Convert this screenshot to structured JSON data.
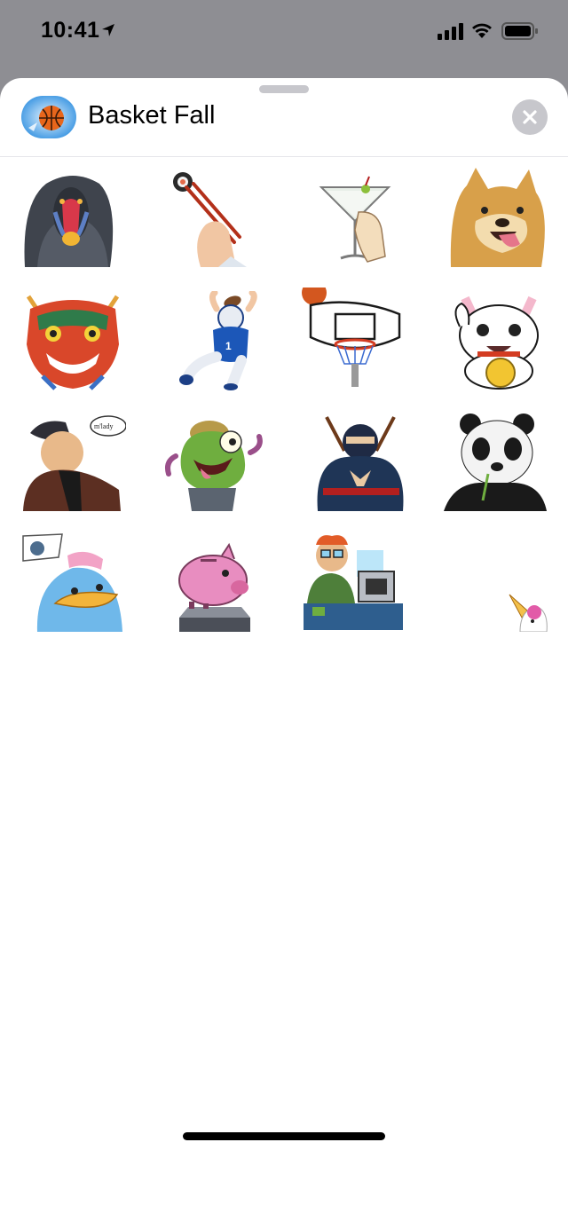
{
  "status_bar": {
    "time": "10:41"
  },
  "header": {
    "app_name": "Basket Fall",
    "app_icon": "basketball-game-icon",
    "close_icon": "close-icon"
  },
  "stickers": [
    {
      "name": "mandrill-baboon"
    },
    {
      "name": "chopsticks-sushi"
    },
    {
      "name": "martini-glass"
    },
    {
      "name": "shiba-dog"
    },
    {
      "name": "chinese-dragon-mask"
    },
    {
      "name": "football-player"
    },
    {
      "name": "basketball-hoop"
    },
    {
      "name": "lucky-cat"
    },
    {
      "name": "fedora-man",
      "text": "m'lady"
    },
    {
      "name": "green-trash-monster"
    },
    {
      "name": "ninja"
    },
    {
      "name": "panda"
    },
    {
      "name": "blue-penguin"
    },
    {
      "name": "piggy-bank"
    },
    {
      "name": "computer-nerd"
    },
    {
      "name": "unicorn"
    }
  ],
  "colors": {
    "sheet_background": "#ffffff",
    "dimmed_background": "#8e8e93",
    "close_button": "#c7c7cc"
  }
}
